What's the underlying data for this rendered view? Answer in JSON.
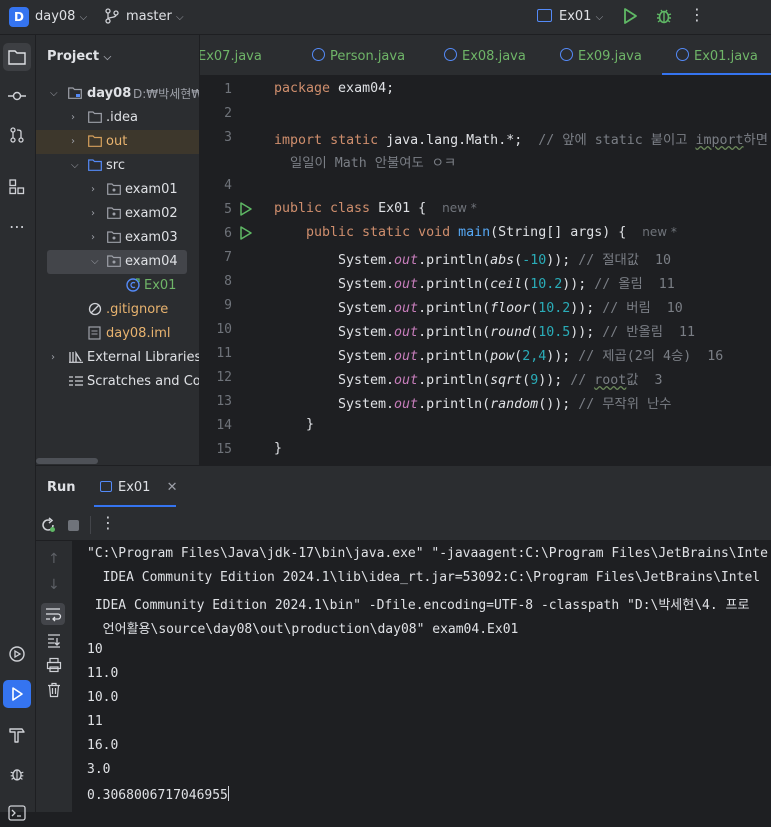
{
  "titlebar": {
    "project_initial": "D",
    "project_name": "day08",
    "branch": "master",
    "run_config": "Ex01"
  },
  "project_panel": {
    "title": "Project",
    "tree": [
      {
        "label": "day08",
        "suffix": "D:₩박세현₩",
        "icon": "folder-module-icon"
      },
      {
        "label": ".idea",
        "icon": "folder-icon"
      },
      {
        "label": "out",
        "icon": "folder-excluded-icon"
      },
      {
        "label": "src",
        "icon": "folder-source-icon"
      },
      {
        "label": "exam01",
        "icon": "package-icon"
      },
      {
        "label": "exam02",
        "icon": "package-icon"
      },
      {
        "label": "exam03",
        "icon": "package-icon"
      },
      {
        "label": "exam04",
        "icon": "package-icon"
      },
      {
        "label": "Ex01",
        "icon": "java-class-icon"
      },
      {
        "label": ".gitignore",
        "icon": "gitignore-icon"
      },
      {
        "label": "day08.iml",
        "icon": "module-file-icon"
      },
      {
        "label": "External Libraries",
        "icon": "libraries-icon"
      },
      {
        "label": "Scratches and Con",
        "icon": "scratches-icon"
      }
    ]
  },
  "editor_tabs": [
    "Ex07.java",
    "Person.java",
    "Ex08.java",
    "Ex09.java",
    "Ex01.java"
  ],
  "editor": {
    "line_numbers": [
      "1",
      "2",
      "3",
      "",
      "4",
      "5",
      "6",
      "7",
      "8",
      "9",
      "10",
      "11",
      "12",
      "13",
      "14",
      "15"
    ],
    "l1_kw": "package",
    "l1_rest": " exam04;",
    "l3_kw1": "import",
    "l3_kw2": "static",
    "l3_rest": " java.lang.Math.*;",
    "l3_comment1": "  // 앞에 static 붙이고 ",
    "l3_comment_wavy": "import",
    "l3_comment2": "하면",
    "l3_wrap": "  일일이 Math 안불여도 ㅇㅋ",
    "l5_kw": "public class",
    "l5_rest": " Ex01 {",
    "l5_hint": "new *",
    "l6_kw": "public static void",
    "l6_fn": "main",
    "l6_rest": "(String[] args) {",
    "l6_hint": "new *",
    "calls": [
      {
        "fn": "abs",
        "arg": "-10",
        "comment": " // 절대값  10"
      },
      {
        "fn": "ceil",
        "arg": "10.2",
        "comment": " // 올림  11"
      },
      {
        "fn": "floor",
        "arg": "10.2",
        "comment": " // 버림  10"
      },
      {
        "fn": "round",
        "arg": "10.5",
        "comment": " // 반올림  11"
      },
      {
        "fn": "pow",
        "arg": "2,4",
        "comment": " // 제곱(2의 4승)  16"
      },
      {
        "fn": "sqrt",
        "arg": "9",
        "comment": " // ",
        "wavy": "root",
        "comment2": "값  3"
      },
      {
        "fn": "random",
        "arg": "",
        "comment": " // 무작위 난수"
      }
    ],
    "sys": "System.",
    "out": "out",
    "println": ".println(",
    "l14": "}",
    "l15": "}"
  },
  "run_panel": {
    "title": "Run",
    "tab": "Ex01",
    "command": [
      "\"C:\\Program Files\\Java\\jdk-17\\bin\\java.exe\" \"-javaagent:C:\\Program Files\\JetBrains\\Inte",
      "  IDEA Community Edition 2024.1\\lib\\idea_rt.jar=53092:C:\\Program Files\\JetBrains\\Intel",
      " IDEA Community Edition 2024.1\\bin\" -Dfile.encoding=UTF-8 -classpath \"D:\\박세현\\4. 프로",
      "  언어활용\\source\\day08\\out\\production\\day08\" exam04.Ex01"
    ],
    "output": [
      "10",
      "11.0",
      "10.0",
      "11",
      "16.0",
      "3.0",
      "0.3068006717046955"
    ]
  }
}
